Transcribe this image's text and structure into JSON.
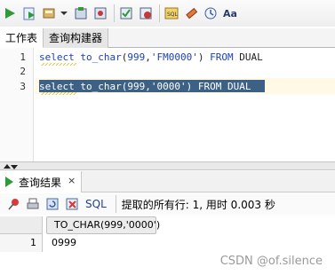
{
  "toolbar": {
    "icons": [
      "run-statement-icon",
      "run-script-icon",
      "commit-icon",
      "rollback-icon",
      "autotrace-icon",
      "explain-plan-icon",
      "sql-tuning-icon",
      "clear-icon",
      "format-icon",
      "history-icon",
      "case-toggle-icon"
    ],
    "case_toggle_label": "Aa"
  },
  "tabs": [
    {
      "label": "工作表",
      "active": true
    },
    {
      "label": "查询构建器",
      "active": false
    }
  ],
  "editor": {
    "line_numbers": [
      "1",
      "2",
      "3"
    ],
    "line1": {
      "kw1": "select",
      "fn": "to_char",
      "open": "(",
      "num": "999",
      "comma": ",",
      "str": "'FM0000'",
      "close": ")",
      "kw2": "FROM",
      "tbl": "DUAL"
    },
    "line3": {
      "kw1": "select",
      "fn": "to_char",
      "open": "(",
      "num": "999",
      "comma": ",",
      "str": "'0000'",
      "close": ")",
      "kw2": "FROM",
      "tbl": "DUAL"
    }
  },
  "results": {
    "tab_label": "查询结果",
    "close_label": "×",
    "sql_link": "SQL",
    "status": "提取的所有行: 1, 用时 0.003 秒",
    "columns": [
      "TO_CHAR(999,'0000')"
    ],
    "rows": [
      {
        "num": "1",
        "value": "0999"
      }
    ]
  },
  "watermark": "CSDN @of.silence",
  "colors": {
    "selection": "#3d6185",
    "keyword": "#1e3fb0",
    "run_green": "#2e9a3a"
  }
}
